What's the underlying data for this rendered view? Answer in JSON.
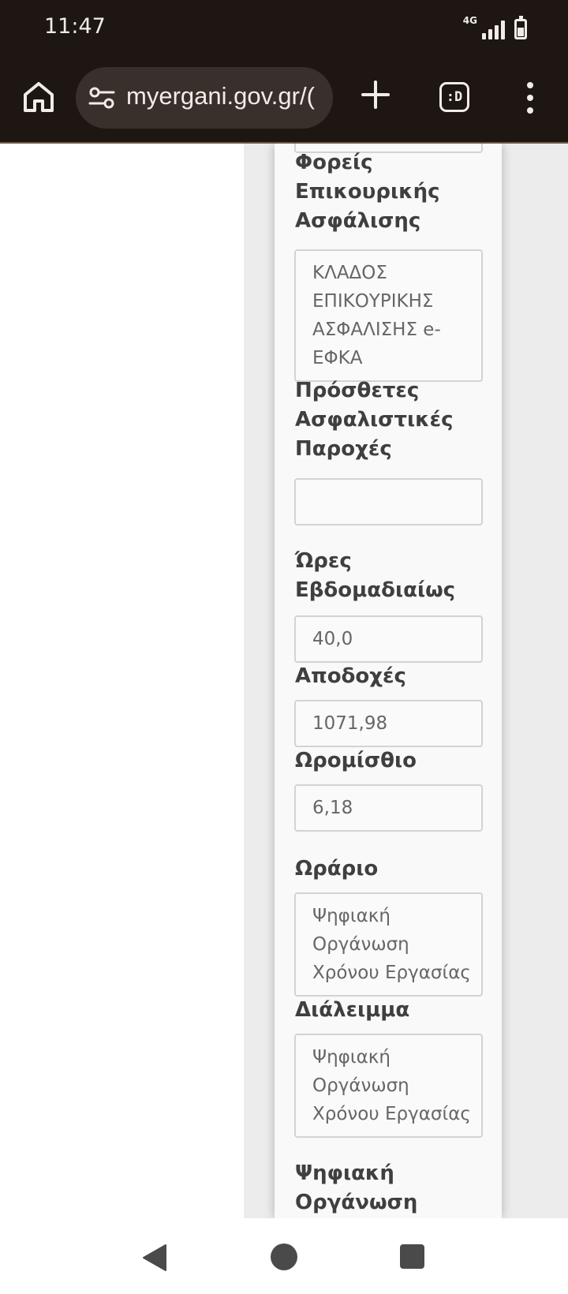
{
  "status_bar": {
    "time": "11:47",
    "network": "4G",
    "icons": [
      "signal-icon",
      "battery-icon"
    ]
  },
  "browser": {
    "url": "myergani.gov.gr/(",
    "tabs_label": ":D",
    "icons": [
      "home-icon",
      "site-settings-icon",
      "plus-icon",
      "tabs-icon",
      "menu-icon"
    ]
  },
  "form": {
    "auxiliary_insurance": {
      "label": "Φορείς Επικουρικής Ασφάλισης",
      "value": "ΚΛΑΔΟΣ ΕΠΙΚΟΥΡΙΚΗΣ ΑΣΦΑΛΙΣΗΣ e-ΕΦΚΑ"
    },
    "additional_benefits": {
      "label": "Πρόσθετες Ασφαλιστικές Παροχές",
      "value": ""
    },
    "weekly_hours": {
      "label": "Ώρες Εβδομαδιαίως",
      "value": "40,0"
    },
    "earnings": {
      "label": "Αποδοχές",
      "value": "1071,98"
    },
    "hourly_wage": {
      "label": "Ωρομίσθιο",
      "value": "6,18"
    },
    "schedule": {
      "label": "Ωράριο",
      "value": "Ψηφιακή Οργάνωση Χρόνου Εργασίας"
    },
    "break": {
      "label": "Διάλειμμα",
      "value": "Ψηφιακή Οργάνωση Χρόνου Εργασίας"
    },
    "digital_organization": {
      "label": "Ψηφιακή Οργάνωση"
    }
  },
  "nav_bar": {
    "icons": [
      "back-icon",
      "home-circle-icon",
      "recents-icon"
    ]
  }
}
